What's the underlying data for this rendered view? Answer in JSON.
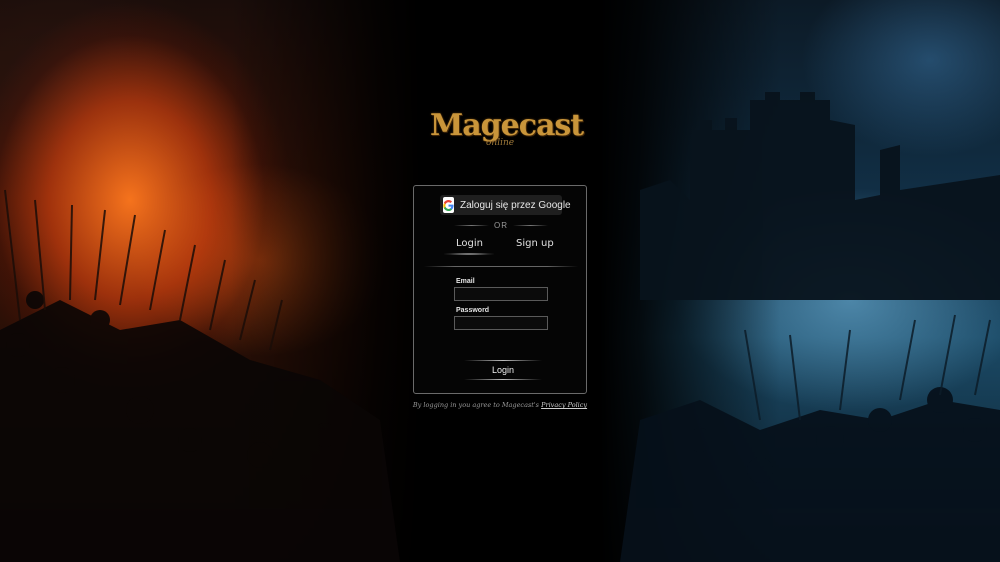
{
  "logo": {
    "main": "Magecast",
    "sub": "online"
  },
  "auth": {
    "google_button_label": "Zaloguj się przez Google",
    "or_text": "OR",
    "tabs": [
      {
        "label": "Login",
        "active": true
      },
      {
        "label": "Sign up",
        "active": false
      }
    ],
    "email_label": "Email",
    "email_value": "",
    "password_label": "Password",
    "password_value": "",
    "submit_label": "Login"
  },
  "footer": {
    "terms_prefix": "By logging in you agree to Magecast's",
    "privacy_link": "Privacy Policy"
  },
  "colors": {
    "logo_gold": "#c9953a",
    "fire_orange": "#e8661a",
    "night_blue": "#1b4a66",
    "card_border": "#6a6a6a"
  },
  "icons": [
    "google-icon"
  ]
}
